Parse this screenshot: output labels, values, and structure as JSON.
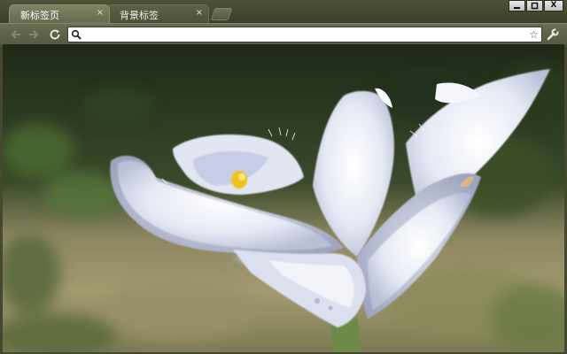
{
  "tabs": [
    {
      "label": "新标签页",
      "active": true
    },
    {
      "label": "背景标签",
      "active": false
    }
  ],
  "tab_close_glyph": "×",
  "window_controls": {
    "minimize": "_",
    "maximize": "□",
    "close": "X"
  },
  "toolbar": {
    "back_icon": "back-arrow-icon",
    "forward_icon": "forward-arrow-icon",
    "reload_icon": "reload-icon",
    "omnibox_value": "",
    "star_icon": "star-icon",
    "wrench_icon": "wrench-icon"
  },
  "theme": {
    "frame_color": "#4f5238",
    "toolbar_color": "#6a6d52",
    "accent": "#7f8263"
  },
  "background_image": "white-iris-flower-photo"
}
